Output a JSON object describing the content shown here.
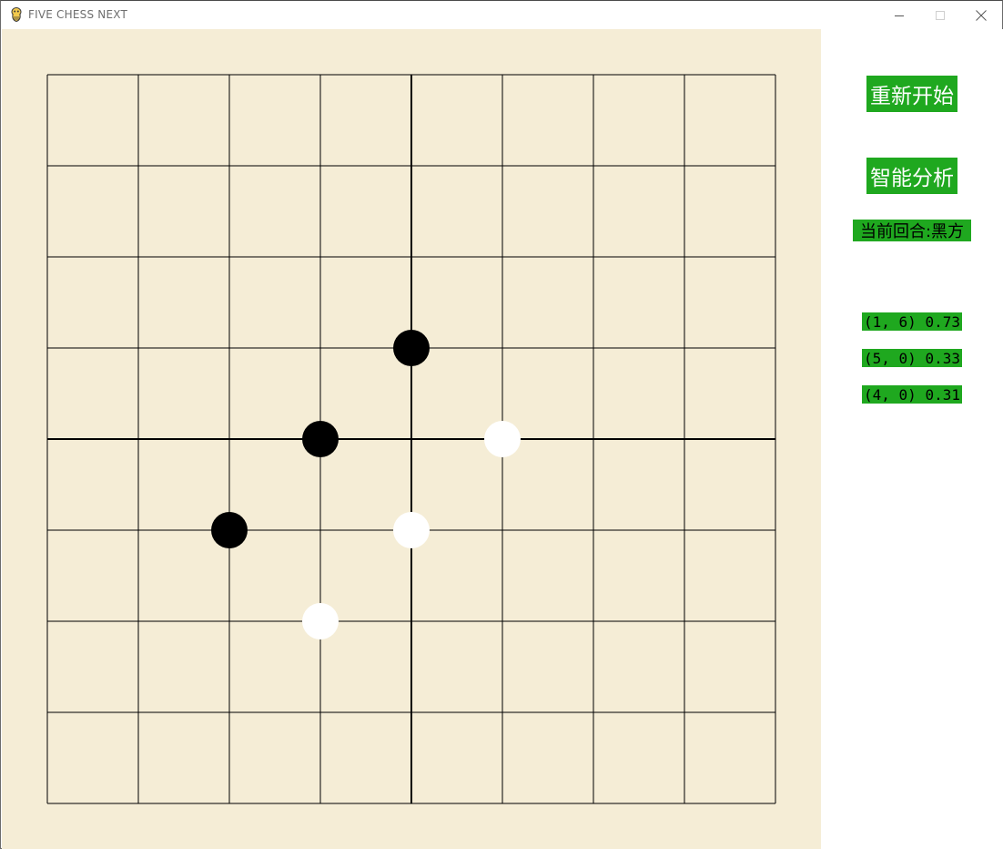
{
  "window": {
    "title": "FIVE CHESS NEXT",
    "icon": "pygame-snake-icon",
    "controls": [
      "minimize-icon",
      "maximize-icon",
      "close-icon"
    ]
  },
  "colors": {
    "board_bg": "#f5edd6",
    "grid_line": "#000000",
    "black_stone": "#000000",
    "white_stone": "#ffffff",
    "button_green": "#1fa81f"
  },
  "board": {
    "grid_size": 9,
    "stones": [
      {
        "color": "black",
        "col": 4,
        "row": 3
      },
      {
        "color": "black",
        "col": 3,
        "row": 4
      },
      {
        "color": "black",
        "col": 2,
        "row": 5
      },
      {
        "color": "white",
        "col": 5,
        "row": 4
      },
      {
        "color": "white",
        "col": 4,
        "row": 5
      },
      {
        "color": "white",
        "col": 3,
        "row": 6
      }
    ]
  },
  "panel": {
    "restart_label": "重新开始",
    "analyze_label": "智能分析",
    "turn_label": "当前回合:黑方",
    "suggestions": [
      {
        "text": "(1, 6) 0.73"
      },
      {
        "text": "(5, 0) 0.33"
      },
      {
        "text": "(4, 0) 0.31"
      }
    ]
  }
}
